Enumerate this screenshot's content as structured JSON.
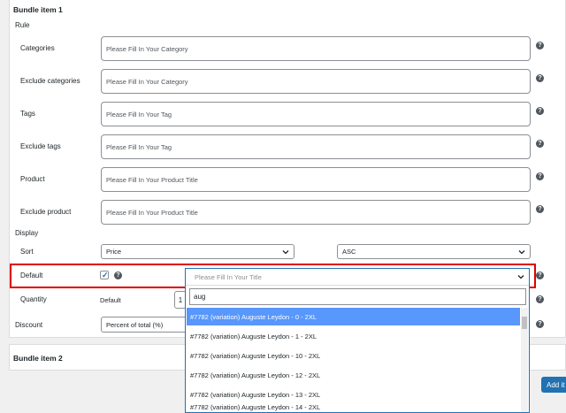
{
  "bundle1": {
    "title": "Bundle item 1",
    "rule_label": "Rule",
    "fields": [
      {
        "label": "Categories",
        "placeholder": "Please Fill In Your Category"
      },
      {
        "label": "Exclude categories",
        "placeholder": "Please Fill In Your Category"
      },
      {
        "label": "Tags",
        "placeholder": "Please Fill In Your Tag"
      },
      {
        "label": "Exclude tags",
        "placeholder": "Please Fill In Your Tag"
      },
      {
        "label": "Product",
        "placeholder": "Please Fill In Your Product Title"
      },
      {
        "label": "Exclude product",
        "placeholder": "Please Fill In Your Product Title"
      }
    ],
    "display_label": "Display",
    "sort": {
      "label": "Sort",
      "field": "Price",
      "order": "ASC"
    },
    "default": {
      "label": "Default",
      "checked": true,
      "title_placeholder": "Please Fill In Your Title"
    },
    "quantity": {
      "label": "Quantity",
      "sub_label": "Default",
      "value": "1"
    },
    "discount": {
      "label": "Discount",
      "type": "Percent of total (%)"
    }
  },
  "bundle2": {
    "title": "Bundle item 2"
  },
  "dropdown": {
    "search_value": "aug",
    "options": [
      "#7782 (variation) Auguste Leydon - 0 - 2XL",
      "#7782 (variation) Auguste Leydon - 1 - 2XL",
      "#7782 (variation) Auguste Leydon - 10 - 2XL",
      "#7782 (variation) Auguste Leydon - 12 - 2XL",
      "#7782 (variation) Auguste Leydon - 13 - 2XL",
      "#7782 (variation) Auguste Leydon - 14 - 2XL"
    ]
  },
  "add_button": "Add it",
  "help_glyph": "?",
  "checkmark_glyph": "✓",
  "colors": {
    "accent": "#2271b1",
    "highlight": "#5897fb",
    "annotation": "#e00000"
  }
}
